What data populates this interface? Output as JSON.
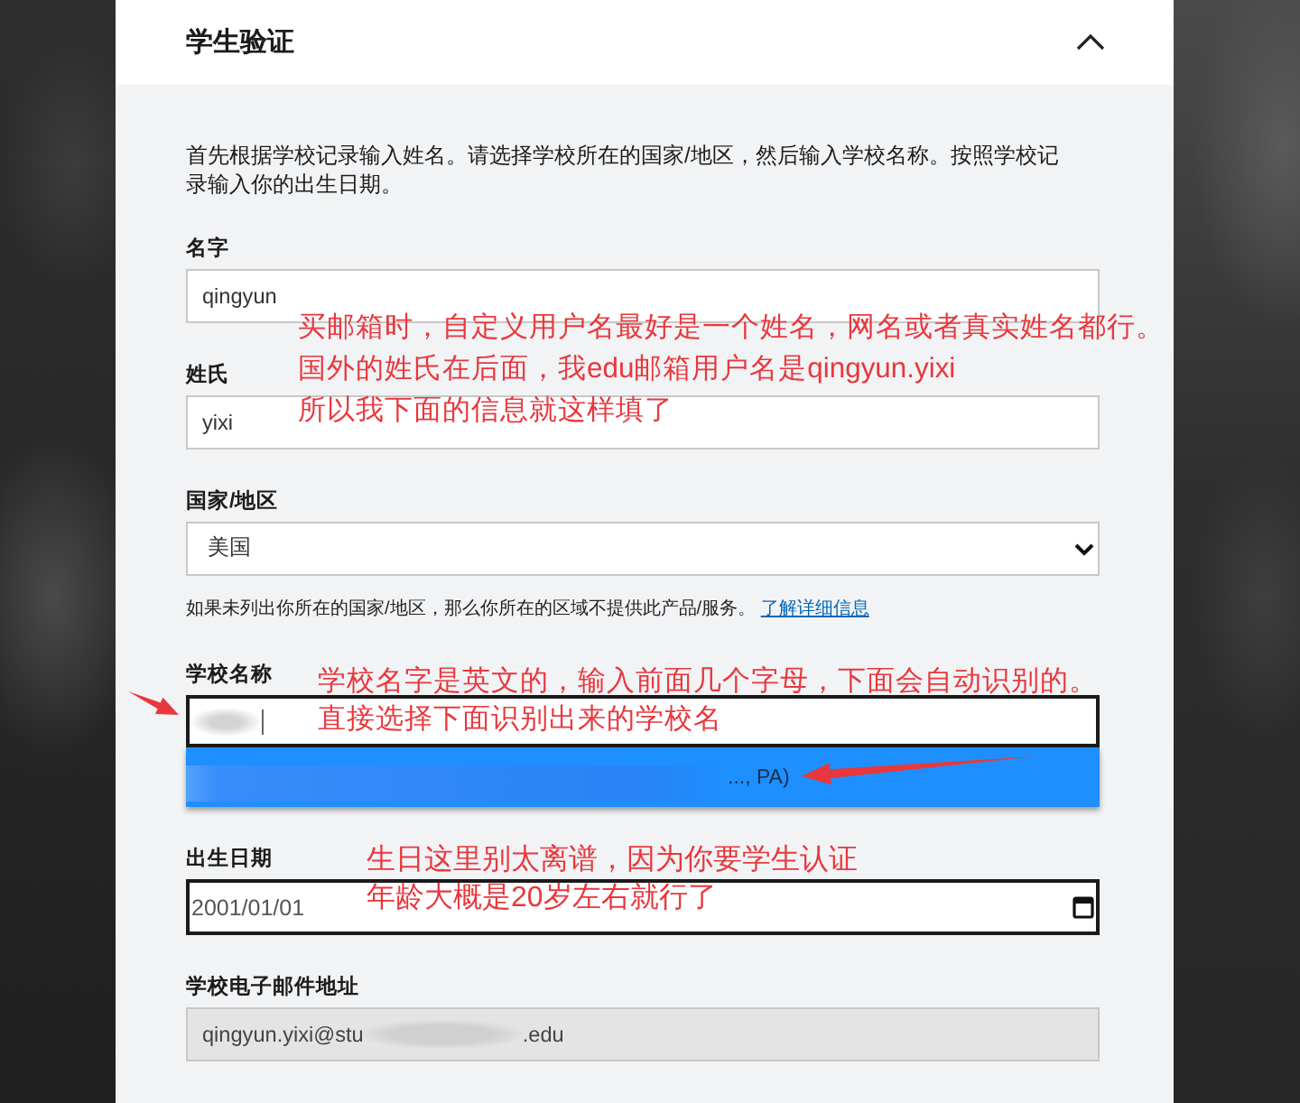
{
  "panel": {
    "title": "学生验证",
    "expanded": true
  },
  "description": "首先根据学校记录输入姓名。请选择学校所在的国家/地区，然后输入学校名称。按照学校记录输入你的出生日期。",
  "fields": [
    {
      "kind": "text",
      "label": "名字",
      "value": "qingyun",
      "focused": false,
      "disabled": false,
      "annotation": [
        "买邮箱时，自定义用户名最好是一个姓名，网名或者真实姓名都行。",
        "国外的姓氏在后面，我edu邮箱用户名是qingyun.yixi",
        "所以我下面的信息就这样填了"
      ]
    },
    {
      "kind": "text",
      "label": "姓氏",
      "value": "yixi",
      "focused": false,
      "disabled": false
    },
    {
      "kind": "select",
      "label": "国家/地区",
      "value": "美国",
      "focused": false,
      "disabled": false,
      "note": "如果未列出你所在的国家/地区，那么你所在的区域不提供此产品/服务。",
      "note_link": "了解详细信息"
    },
    {
      "kind": "autocomplete",
      "label": "学校名称",
      "focused": true,
      "disabled": false,
      "suggestion": {
        "text": "..., PA)",
        "selected": true
      },
      "annotation": [
        "学校名字是英文的，输入前面几个字母，下面会自动识别的。",
        "直接选择下面识别出来的学校名"
      ]
    },
    {
      "kind": "date",
      "label": "出生日期",
      "value": "2001/01/01",
      "focused": true,
      "disabled": false,
      "annotation": [
        "生日这里别太离谱，因为你要学生认证",
        "年龄大概是20岁左右就行了"
      ]
    },
    {
      "kind": "email",
      "label": "学校电子邮件地址",
      "value_parts": [
        "qingyun.yixi@stu",
        ".edu"
      ],
      "focused": false,
      "disabled": true
    }
  ]
}
